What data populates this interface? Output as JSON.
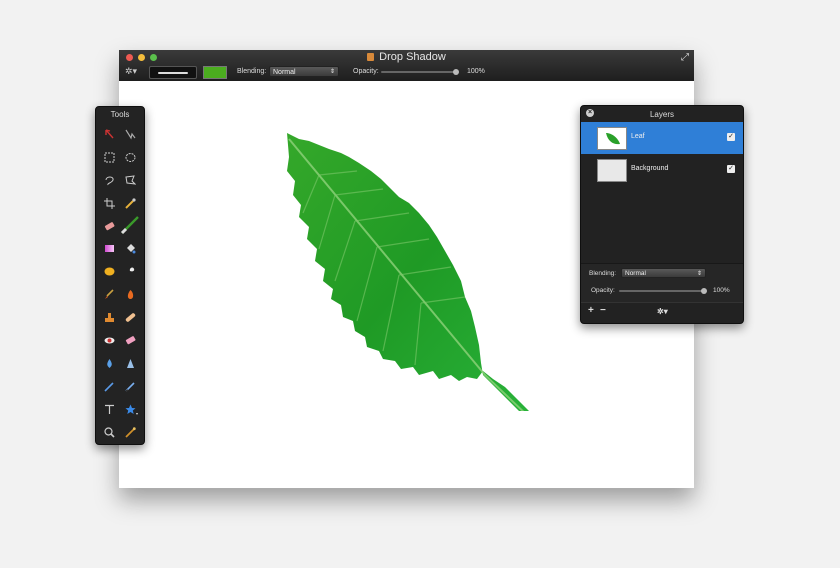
{
  "window": {
    "title": "Drop Shadow",
    "toolbar": {
      "color_well": "#4bad1f",
      "blending_label": "Blending:",
      "blending_value": "Normal",
      "opacity_label": "Opacity:",
      "opacity_value": "100%"
    }
  },
  "tools_panel": {
    "title": "Tools",
    "tools": [
      {
        "icon": "arrow-select-icon",
        "selected": false
      },
      {
        "icon": "move-icon",
        "selected": false
      },
      {
        "icon": "rect-marquee-icon",
        "selected": false
      },
      {
        "icon": "ellipse-marquee-icon",
        "selected": false
      },
      {
        "icon": "lasso-icon",
        "selected": false
      },
      {
        "icon": "polygon-lasso-icon",
        "selected": false
      },
      {
        "icon": "crop-icon",
        "selected": false
      },
      {
        "icon": "eyedropper-icon",
        "selected": false
      },
      {
        "icon": "eraser-icon",
        "selected": false
      },
      {
        "icon": "paintbrush-icon",
        "selected": true
      },
      {
        "icon": "gradient-icon",
        "selected": false
      },
      {
        "icon": "paint-bucket-icon",
        "selected": false
      },
      {
        "icon": "sponge-icon",
        "selected": false
      },
      {
        "icon": "smudge-icon",
        "selected": false
      },
      {
        "icon": "brush-icon",
        "selected": false
      },
      {
        "icon": "burn-icon",
        "selected": false
      },
      {
        "icon": "stamp-icon",
        "selected": false
      },
      {
        "icon": "bandage-icon",
        "selected": false
      },
      {
        "icon": "red-eye-icon",
        "selected": false
      },
      {
        "icon": "pink-eraser-icon",
        "selected": false
      },
      {
        "icon": "blur-drop-icon",
        "selected": false
      },
      {
        "icon": "sharpen-icon",
        "selected": false
      },
      {
        "icon": "pen-icon",
        "selected": false
      },
      {
        "icon": "pencil-icon",
        "selected": false
      },
      {
        "icon": "text-icon",
        "selected": false
      },
      {
        "icon": "shape-star-icon",
        "selected": false
      },
      {
        "icon": "zoom-icon",
        "selected": false
      },
      {
        "icon": "color-picker-icon",
        "selected": false
      }
    ]
  },
  "layers_panel": {
    "title": "Layers",
    "layers": [
      {
        "name": "Leaf",
        "visible": true,
        "selected": true
      },
      {
        "name": "Background",
        "visible": true,
        "selected": false
      }
    ],
    "blending_label": "Blending:",
    "blending_value": "Normal",
    "opacity_label": "Opacity:",
    "opacity_value": "100%",
    "footer": {
      "add": "+",
      "remove": "−"
    }
  }
}
